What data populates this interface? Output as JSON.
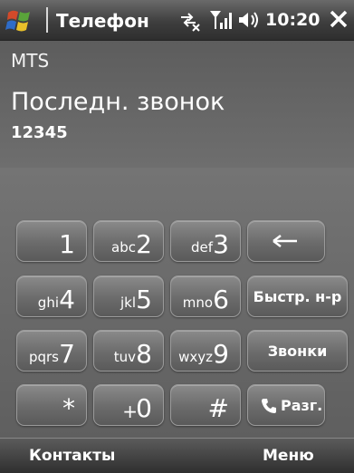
{
  "titlebar": {
    "app_title": "Телефон",
    "time": "10:20",
    "icons": [
      "windows-start-icon",
      "connectivity-icon",
      "signal-icon",
      "volume-icon",
      "close-icon"
    ]
  },
  "info": {
    "operator": "MTS",
    "last_call_label": "Последн. звонок",
    "last_call_number": "12345"
  },
  "keypad": {
    "keys": [
      {
        "digit": "1",
        "letters": ""
      },
      {
        "digit": "2",
        "letters": "abc"
      },
      {
        "digit": "3",
        "letters": "def"
      },
      {
        "digit": "4",
        "letters": "ghi"
      },
      {
        "digit": "5",
        "letters": "jkl"
      },
      {
        "digit": "6",
        "letters": "mno"
      },
      {
        "digit": "7",
        "letters": "pqrs"
      },
      {
        "digit": "8",
        "letters": "tuv"
      },
      {
        "digit": "9",
        "letters": "wxyz"
      },
      {
        "digit": "*",
        "letters": ""
      },
      {
        "digit": "0",
        "letters": "+"
      },
      {
        "digit": "#",
        "letters": ""
      }
    ],
    "commands": {
      "backspace": "←",
      "speed_dial": "Быстр. н-р",
      "calls": "Звонки",
      "talk": "Разг."
    }
  },
  "softkeys": {
    "left": "Контакты",
    "right": "Меню"
  }
}
